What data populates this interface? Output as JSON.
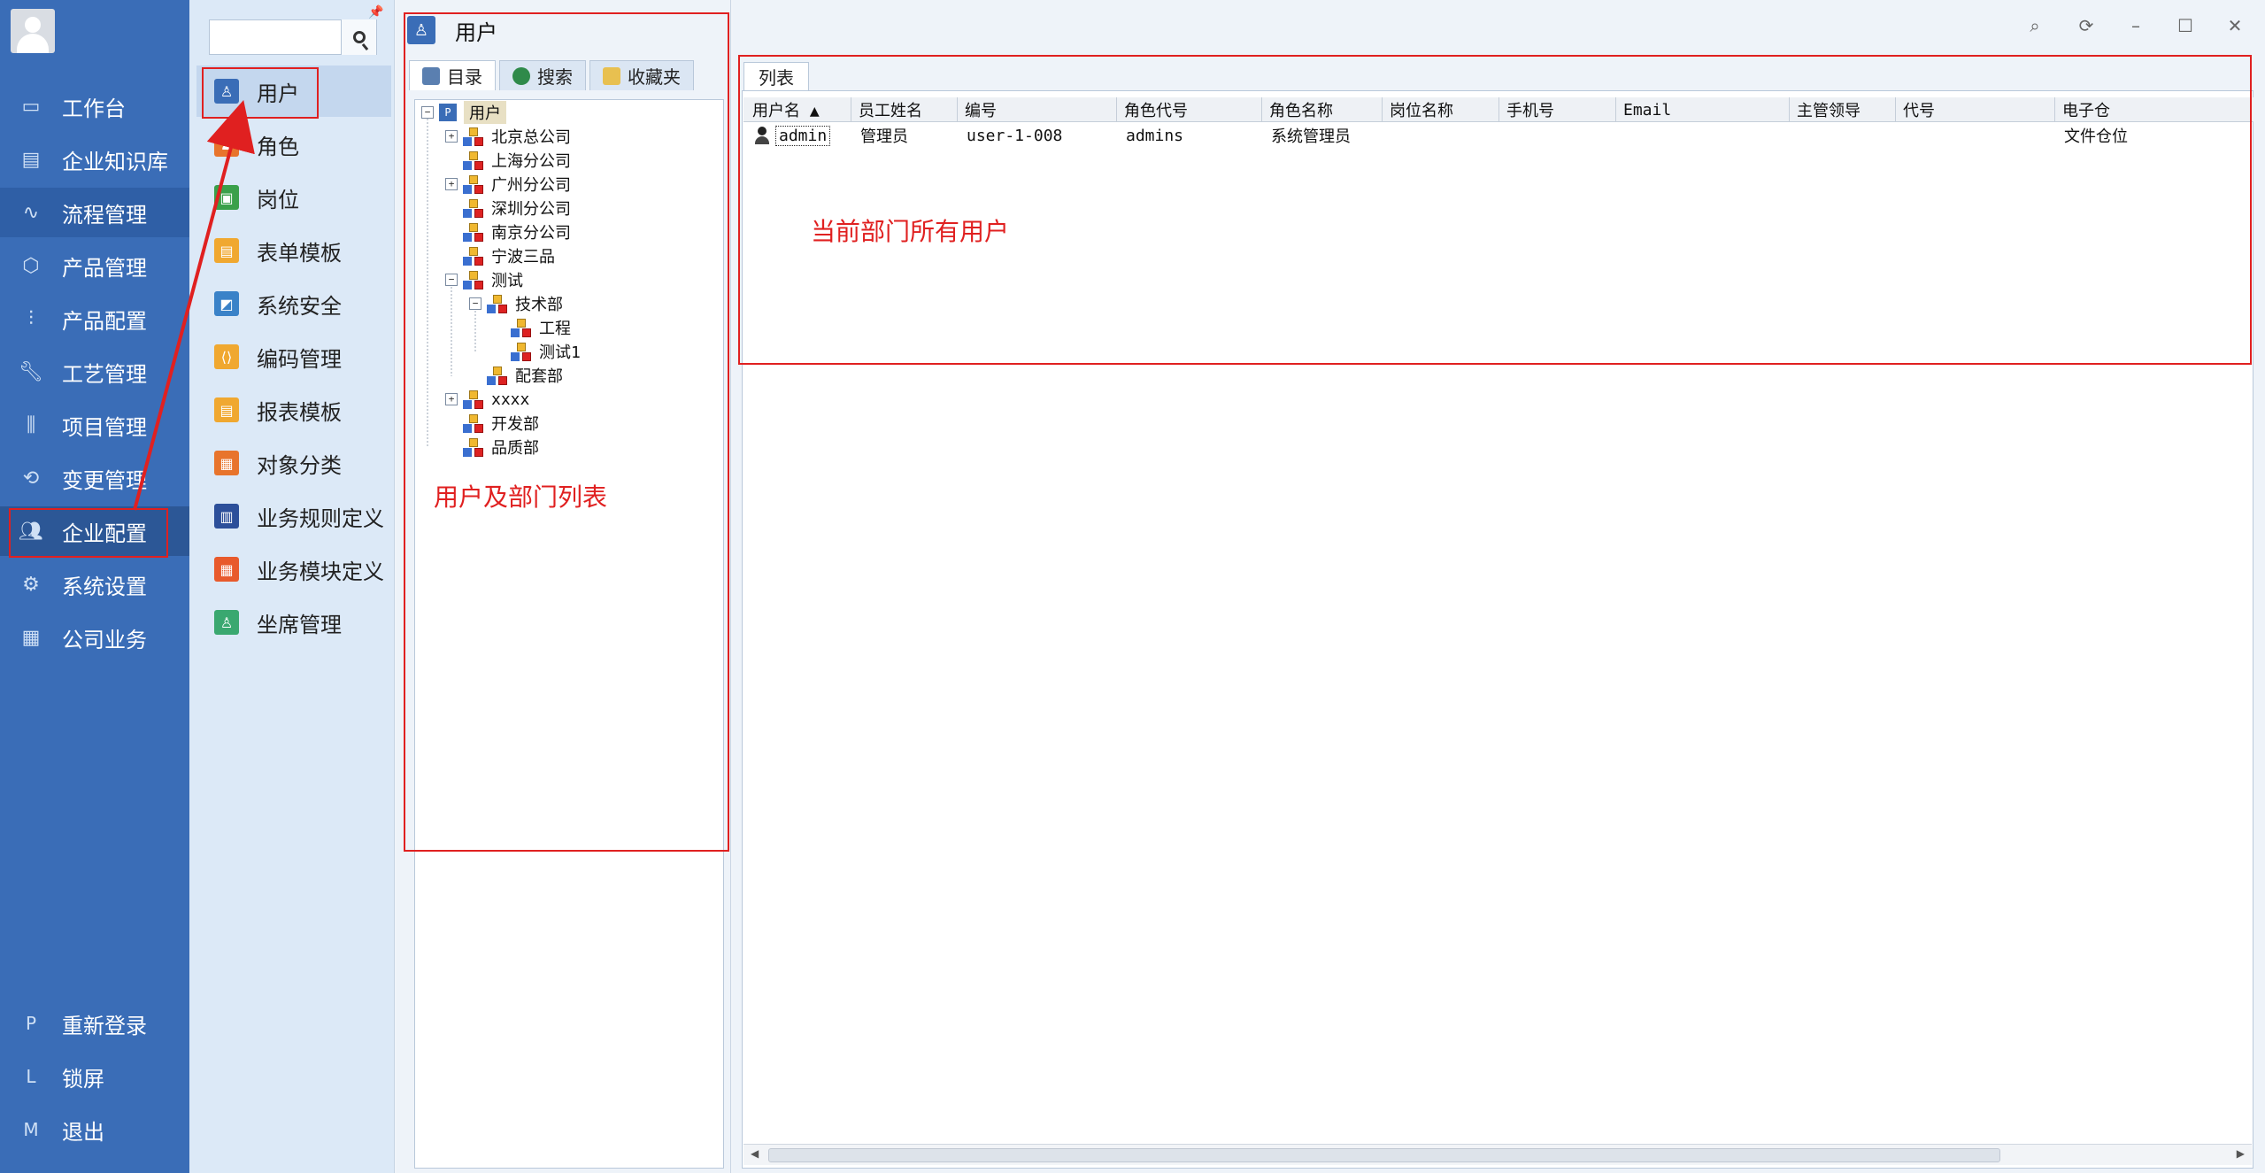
{
  "sidebar": {
    "items": [
      {
        "label": "工作台",
        "icon": "monitor-icon"
      },
      {
        "label": "企业知识库",
        "icon": "book-icon"
      },
      {
        "label": "流程管理",
        "icon": "flow-icon"
      },
      {
        "label": "产品管理",
        "icon": "box-icon"
      },
      {
        "label": "产品配置",
        "icon": "sliders-icon"
      },
      {
        "label": "工艺管理",
        "icon": "wrench-icon"
      },
      {
        "label": "项目管理",
        "icon": "project-icon"
      },
      {
        "label": "变更管理",
        "icon": "change-icon"
      },
      {
        "label": "企业配置",
        "icon": "users-icon"
      },
      {
        "label": "系统设置",
        "icon": "gear-icon"
      },
      {
        "label": "公司业务",
        "icon": "grid-icon"
      }
    ],
    "bottom": [
      {
        "letter": "P",
        "label": "重新登录"
      },
      {
        "letter": "L",
        "label": "锁屏"
      },
      {
        "letter": "M",
        "label": "退出"
      }
    ]
  },
  "submenu": {
    "items": [
      {
        "label": "用户",
        "color": "#3a6db7",
        "glyph": "♙"
      },
      {
        "label": "角色",
        "color": "#e8742c",
        "glyph": "♟"
      },
      {
        "label": "岗位",
        "color": "#3aa04a",
        "glyph": "▣"
      },
      {
        "label": "表单模板",
        "color": "#f0a830",
        "glyph": "▤"
      },
      {
        "label": "系统安全",
        "color": "#3a82c8",
        "glyph": "◩"
      },
      {
        "label": "编码管理",
        "color": "#f0a830",
        "glyph": "⟨⟩"
      },
      {
        "label": "报表模板",
        "color": "#f0a830",
        "glyph": "▤"
      },
      {
        "label": "对象分类",
        "color": "#e8742c",
        "glyph": "▦"
      },
      {
        "label": "业务规则定义",
        "color": "#2c4f9a",
        "glyph": "▥"
      },
      {
        "label": "业务模块定义",
        "color": "#e85a2c",
        "glyph": "▦"
      },
      {
        "label": "坐席管理",
        "color": "#3aa870",
        "glyph": "♙"
      }
    ]
  },
  "middle": {
    "title": "用户",
    "tabs": [
      "目录",
      "搜索",
      "收藏夹"
    ],
    "tree": [
      {
        "label": "用户",
        "level": 0,
        "exp": "−",
        "root": true
      },
      {
        "label": "北京总公司",
        "level": 1,
        "exp": "+"
      },
      {
        "label": "上海分公司",
        "level": 1,
        "exp": ""
      },
      {
        "label": "广州分公司",
        "level": 1,
        "exp": "+"
      },
      {
        "label": "深圳分公司",
        "level": 1,
        "exp": ""
      },
      {
        "label": "南京分公司",
        "level": 1,
        "exp": ""
      },
      {
        "label": "宁波三品",
        "level": 1,
        "exp": ""
      },
      {
        "label": "测试",
        "level": 1,
        "exp": "−"
      },
      {
        "label": "技术部",
        "level": 2,
        "exp": "−"
      },
      {
        "label": "工程",
        "level": 3,
        "exp": ""
      },
      {
        "label": "测试1",
        "level": 3,
        "exp": ""
      },
      {
        "label": "配套部",
        "level": 2,
        "exp": ""
      },
      {
        "label": "xxxx",
        "level": 1,
        "exp": "+"
      },
      {
        "label": "开发部",
        "level": 1,
        "exp": ""
      },
      {
        "label": "品质部",
        "level": 1,
        "exp": ""
      }
    ]
  },
  "right": {
    "list_tab": "列表",
    "columns": [
      "用户名 ▲",
      "员工姓名",
      "编号",
      "角色代号",
      "角色名称",
      "岗位名称",
      "手机号",
      "Email",
      "主管领导",
      "代号",
      "电子仓"
    ],
    "rows": [
      [
        "admin",
        "管理员",
        "user-1-008",
        "admins",
        "系统管理员",
        "",
        "",
        "",
        "",
        "",
        "文件仓位"
      ]
    ]
  },
  "annotations": {
    "tree_note": "用户及部门列表",
    "grid_note": "当前部门所有用户"
  }
}
